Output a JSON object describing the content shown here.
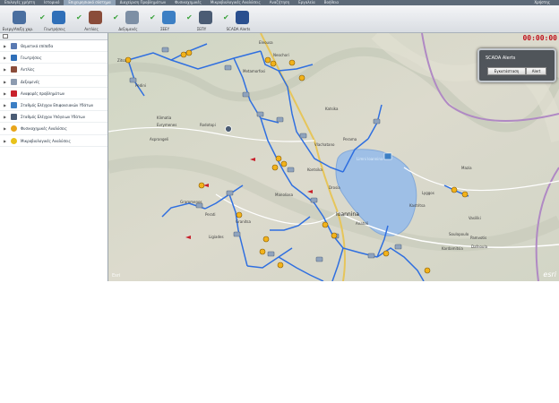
{
  "menu": {
    "items": [
      "Επιλογές χρήστη",
      "Ιστορικό",
      "Επιχειρησιακό σύστημα",
      "Διαχείριση Προβλημάτων",
      "Φυσικοχημικές",
      "Μικροβιολογικές Αναλύσεις",
      "Αναζήτηση",
      "Εργαλεία",
      "Βοήθεια"
    ],
    "active_index": 2,
    "user": "Χρήστης"
  },
  "toolbar": {
    "buttons": [
      {
        "label": "Ενεργ/Απ/ξη χαρ.",
        "icon": "layers-toggle-icon",
        "checked": false,
        "color": "#4a6fa0"
      },
      {
        "label": "Γεωτρήσεις",
        "icon": "borehole-icon",
        "checked": true,
        "color": "#2f6fb8"
      },
      {
        "label": "Αντλίες",
        "icon": "pump-icon",
        "checked": true,
        "color": "#8a4c3a"
      },
      {
        "label": "Δεξαμενές",
        "icon": "tank-icon",
        "checked": true,
        "color": "#7d8fa5"
      },
      {
        "label": "ΣΕΕΥ",
        "icon": "water-control-icon",
        "checked": true,
        "color": "#3c7fc4"
      },
      {
        "label": "ΣΕΠΥ",
        "icon": "monitor-station-icon",
        "checked": true,
        "color": "#4b5c74"
      },
      {
        "label": "SCADA Alerts",
        "icon": "scada-icon",
        "checked": true,
        "color": "#2a4f8f"
      }
    ]
  },
  "layers": {
    "items": [
      {
        "label": "Θεματικά επίπεδα",
        "icon": "thematic-layers-icon",
        "color": "#5a7ab2"
      },
      {
        "label": "Γεωτρήσεις",
        "icon": "borehole-icon",
        "color": "#2f6fb8"
      },
      {
        "label": "Αντλίες",
        "icon": "pump-icon",
        "color": "#8a4c3a"
      },
      {
        "label": "Δεξαμενές",
        "icon": "tank-icon",
        "color": "#8c9bb0"
      },
      {
        "label": "Αναφορές προβλημάτων",
        "icon": "problem-report-icon",
        "color": "#c8202b"
      },
      {
        "label": "Σταθμός Ελέγχου Επιφανειακών Υδάτων",
        "icon": "surface-water-icon",
        "color": "#3c7fc4"
      },
      {
        "label": "Σταθμός Ελέγχου Υπόγειων Υδάτων",
        "icon": "groundwater-icon",
        "color": "#4b5c74"
      },
      {
        "label": "Φυσικοχημικές Αναλύσεις",
        "icon": "physchem-icon",
        "color": "#e8a51a"
      },
      {
        "label": "Μικροβιολογικές Αναλύσεις",
        "icon": "microbio-icon",
        "color": "#e8c21a"
      }
    ]
  },
  "map": {
    "clock": "00:00:00",
    "alerts_title": "SCADA Alerts",
    "alerts_button_1": "Εγκατάσταση",
    "alerts_button_2": "Alert",
    "city_label": "Ioannina",
    "lake_label": "Limni Ioannina",
    "attribution": "esri",
    "credit": "Esri"
  },
  "map_labels": [
    "Zitsa",
    "Pedini",
    "Eleousa",
    "Metamorfosi",
    "Perama",
    "Katsika",
    "Neochori",
    "Rodotopi",
    "Asprangeli",
    "Vasiliki",
    "Dafnoula",
    "Kardamitsia",
    "Pamvotis",
    "Kastritsa",
    "Vlachatano",
    "Manoliasa",
    "Perati",
    "Grammenos",
    "Granitsa",
    "Klimatia",
    "Evrymenes",
    "Lyggos",
    "Mazia",
    "Soulopoulo",
    "Ligiades",
    "Drosia",
    "Kontsika",
    "Anatoli"
  ]
}
